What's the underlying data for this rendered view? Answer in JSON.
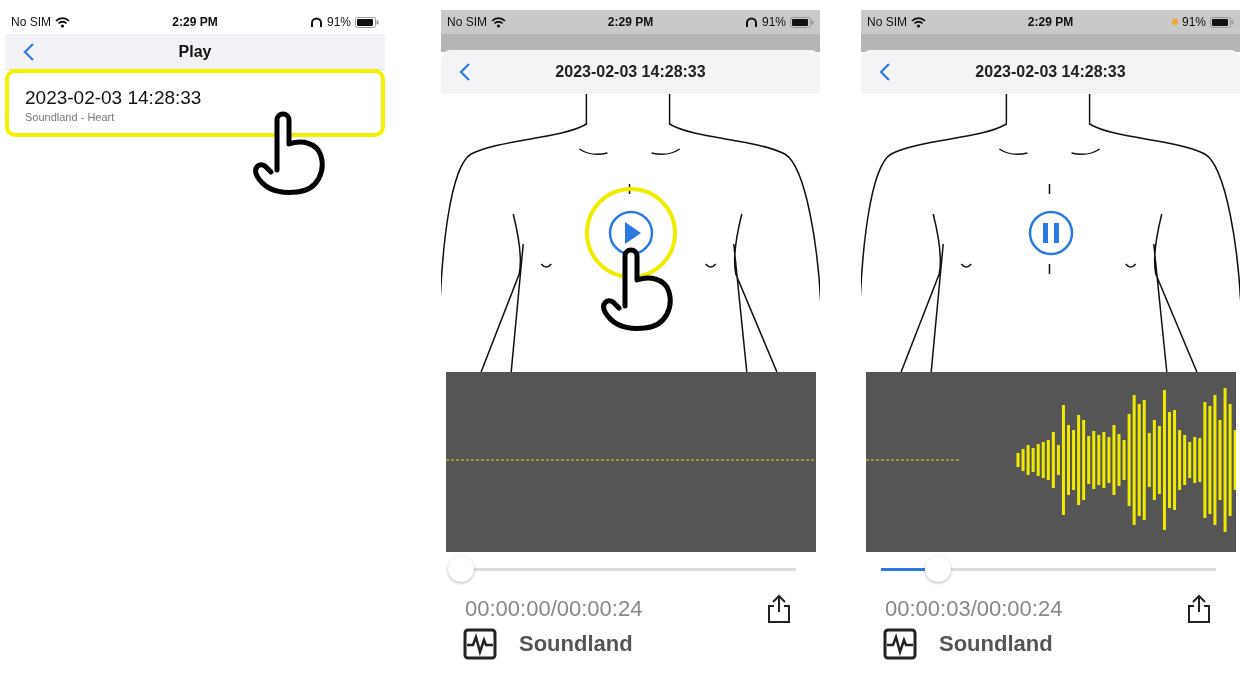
{
  "screens": [
    {
      "kind": "list",
      "status": {
        "carrier": "No SIM",
        "time": "2:29 PM",
        "battery": "91%",
        "headphones": true,
        "mic_in_use": false
      },
      "nav_title": "Play",
      "items": [
        {
          "title": "2023-02-03 14:28:33",
          "subtitle": "Soundland - Heart",
          "highlighted": true
        }
      ]
    },
    {
      "kind": "player",
      "status": {
        "carrier": "No SIM",
        "time": "2:29 PM",
        "battery": "91%",
        "headphones": true,
        "mic_in_use": false
      },
      "title": "2023-02-03 14:28:33",
      "playing": false,
      "play_highlighted": true,
      "level": 0,
      "time": "00:00:00/00:00:24",
      "brand": "Soundland"
    },
    {
      "kind": "player",
      "status": {
        "carrier": "No SIM",
        "time": "2:29 PM",
        "battery": "91%",
        "headphones": false,
        "mic_in_use": true
      },
      "title": "2023-02-03 14:28:33",
      "playing": true,
      "play_highlighted": false,
      "level": 0.17,
      "time": "00:00:03/00:00:24",
      "brand": "Soundland"
    }
  ]
}
